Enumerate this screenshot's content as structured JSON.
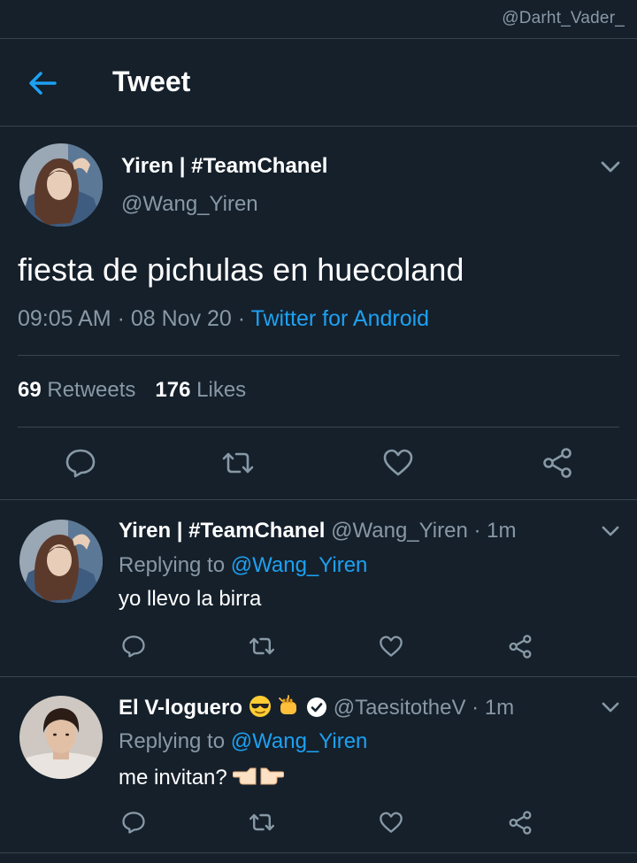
{
  "watermark": "@Darht_Vader_",
  "header": {
    "title": "Tweet",
    "back_icon": "arrow-left-icon"
  },
  "colors": {
    "background": "#15202b",
    "accent": "#1da1f2",
    "muted": "#8899a6",
    "divider": "#38444d"
  },
  "tweet": {
    "author_name": "Yiren | #TeamChanel",
    "author_handle": "@Wang_Yiren",
    "text": "fiesta de pichulas en huecoland",
    "time": "09:05 AM",
    "date": "08 Nov 20",
    "source": "Twitter for Android",
    "retweets": "69",
    "retweets_label": "Retweets",
    "likes": "176",
    "likes_label": "Likes"
  },
  "replies": [
    {
      "name": "Yiren | #TeamChanel",
      "handle": "@Wang_Yiren",
      "time": "1m",
      "replying_label": "Replying to",
      "mention": "@Wang_Yiren",
      "text": "yo llevo la birra"
    },
    {
      "name": "El V-loguero",
      "name_emojis": "😎👊",
      "verified": true,
      "handle": "@TaesitotheV",
      "time": "1m",
      "replying_label": "Replying to",
      "mention": "@Wang_Yiren",
      "text": "me invitan?",
      "text_emojis": "👉👈"
    }
  ]
}
